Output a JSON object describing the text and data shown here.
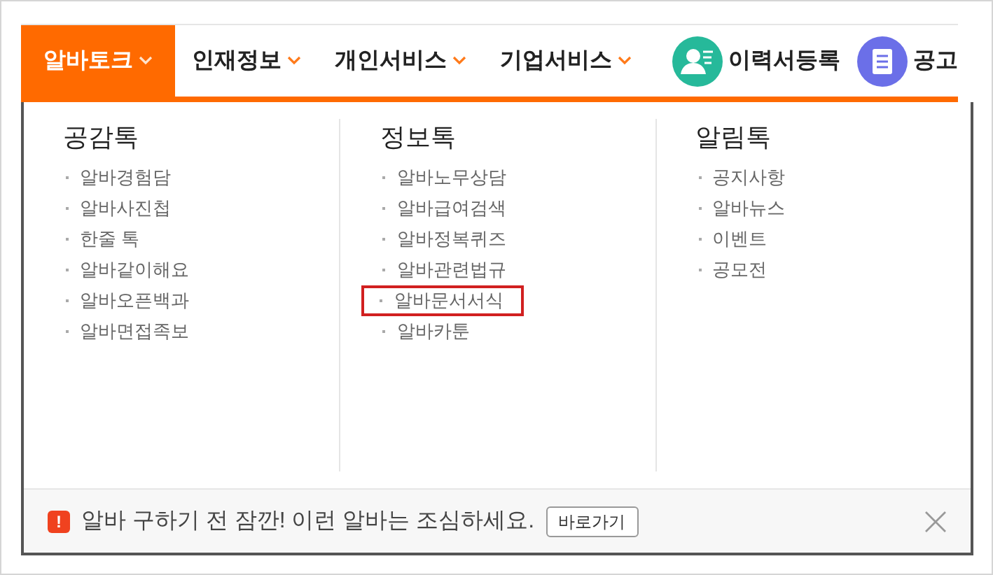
{
  "nav": {
    "tabs": [
      {
        "label": "알바토크",
        "selected": true
      },
      {
        "label": "인재정보",
        "selected": false
      },
      {
        "label": "개인서비스",
        "selected": false
      },
      {
        "label": "기업서비스",
        "selected": false
      }
    ],
    "actions": [
      {
        "label": "이력서등록",
        "kind": "resume",
        "color": "#26b99a"
      },
      {
        "label": "공고",
        "kind": "posting",
        "color": "#6b6fe8"
      }
    ]
  },
  "menu": {
    "columns": [
      {
        "title": "공감톡",
        "items": [
          {
            "label": "알바경험담",
            "highlighted": false
          },
          {
            "label": "알바사진첩",
            "highlighted": false
          },
          {
            "label": "한줄 톡",
            "highlighted": false
          },
          {
            "label": "알바같이해요",
            "highlighted": false
          },
          {
            "label": "알바오픈백과",
            "highlighted": false
          },
          {
            "label": "알바면접족보",
            "highlighted": false
          }
        ]
      },
      {
        "title": "정보톡",
        "items": [
          {
            "label": "알바노무상담",
            "highlighted": false
          },
          {
            "label": "알바급여검색",
            "highlighted": false
          },
          {
            "label": "알바정복퀴즈",
            "highlighted": false
          },
          {
            "label": "알바관련법규",
            "highlighted": false
          },
          {
            "label": "알바문서서식",
            "highlighted": true
          },
          {
            "label": "알바카툰",
            "highlighted": false
          }
        ]
      },
      {
        "title": "알림톡",
        "items": [
          {
            "label": "공지사항",
            "highlighted": false
          },
          {
            "label": "알바뉴스",
            "highlighted": false
          },
          {
            "label": "이벤트",
            "highlighted": false
          },
          {
            "label": "공모전",
            "highlighted": false
          }
        ]
      }
    ],
    "notice": {
      "icon": "!",
      "text": "알바 구하기 전 잠깐! 이런 알바는 조심하세요.",
      "button": "바로가기"
    }
  }
}
